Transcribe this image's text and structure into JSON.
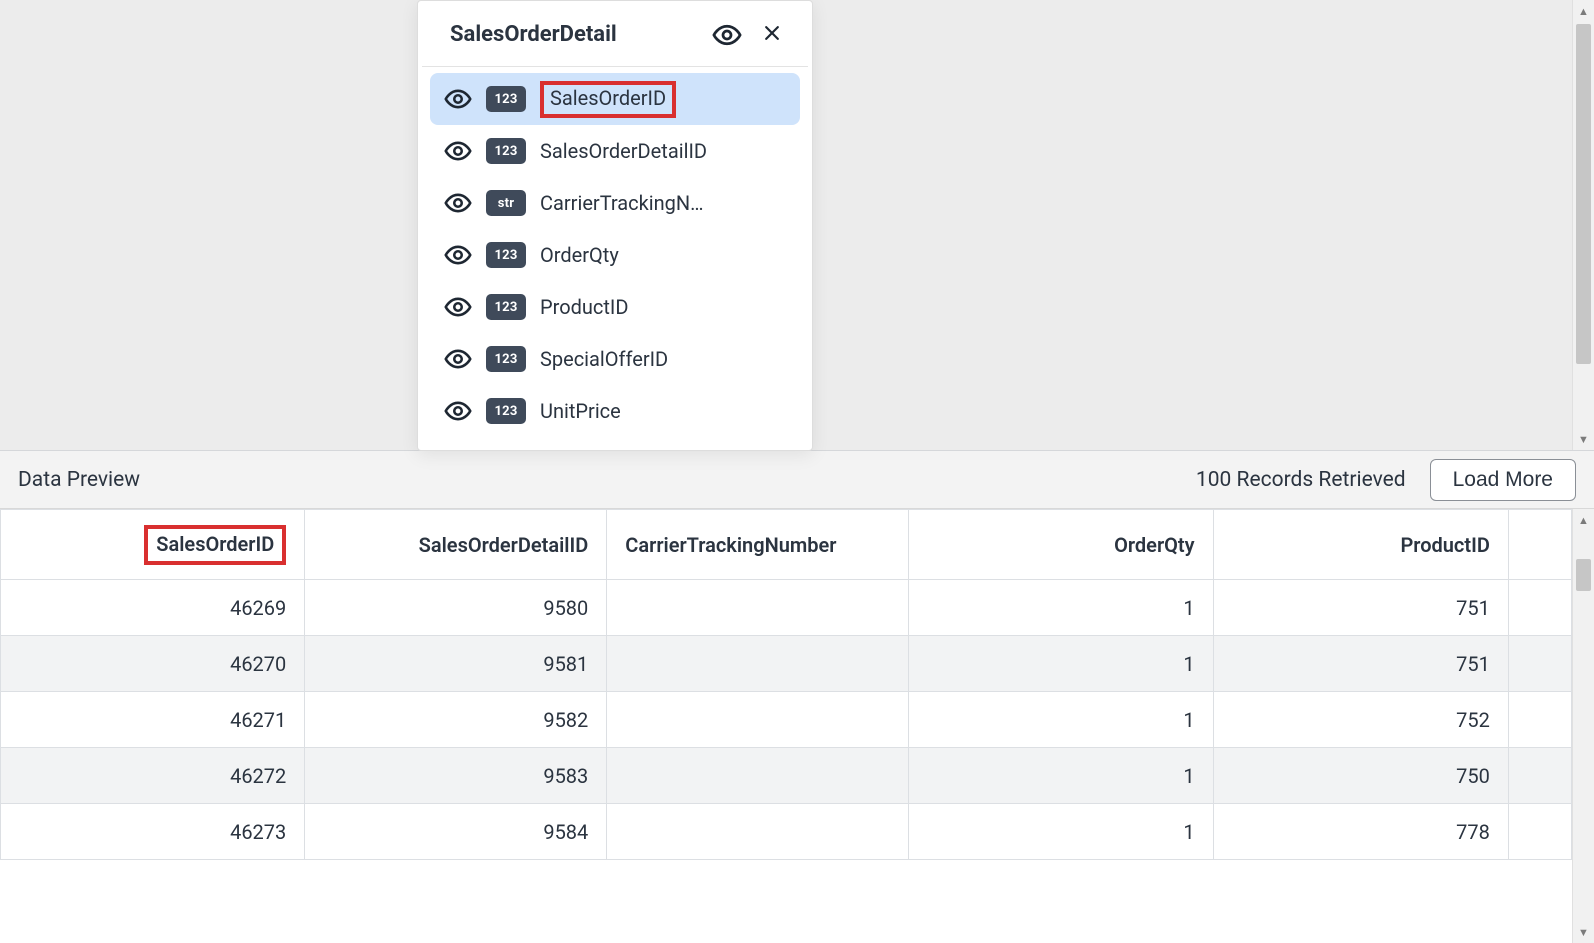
{
  "popup": {
    "title": "SalesOrderDetail",
    "fields": [
      {
        "type": "123",
        "name": "SalesOrderID",
        "selected": true
      },
      {
        "type": "123",
        "name": "SalesOrderDetailID",
        "selected": false
      },
      {
        "type": "str",
        "name": "CarrierTrackingN…",
        "selected": false
      },
      {
        "type": "123",
        "name": "OrderQty",
        "selected": false
      },
      {
        "type": "123",
        "name": "ProductID",
        "selected": false
      },
      {
        "type": "123",
        "name": "SpecialOfferID",
        "selected": false
      },
      {
        "type": "123",
        "name": "UnitPrice",
        "selected": false
      }
    ]
  },
  "panel": {
    "title": "Data Preview",
    "records_text": "100 Records Retrieved",
    "load_more": "Load More"
  },
  "grid": {
    "columns": [
      "SalesOrderID",
      "SalesOrderDetailID",
      "CarrierTrackingNumber",
      "OrderQty",
      "ProductID"
    ],
    "rows": [
      {
        "SalesOrderID": "46269",
        "SalesOrderDetailID": "9580",
        "CarrierTrackingNumber": "",
        "OrderQty": "1",
        "ProductID": "751"
      },
      {
        "SalesOrderID": "46270",
        "SalesOrderDetailID": "9581",
        "CarrierTrackingNumber": "",
        "OrderQty": "1",
        "ProductID": "751"
      },
      {
        "SalesOrderID": "46271",
        "SalesOrderDetailID": "9582",
        "CarrierTrackingNumber": "",
        "OrderQty": "1",
        "ProductID": "752"
      },
      {
        "SalesOrderID": "46272",
        "SalesOrderDetailID": "9583",
        "CarrierTrackingNumber": "",
        "OrderQty": "1",
        "ProductID": "750"
      },
      {
        "SalesOrderID": "46273",
        "SalesOrderDetailID": "9584",
        "CarrierTrackingNumber": "",
        "OrderQty": "1",
        "ProductID": "778"
      }
    ]
  }
}
